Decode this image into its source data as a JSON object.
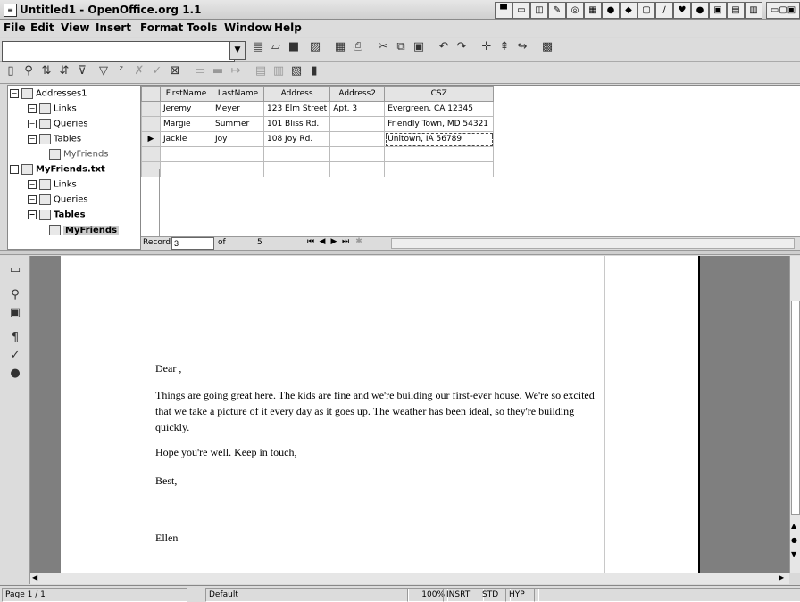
{
  "window": {
    "title": "Untitled1 - OpenOffice.org 1.1"
  },
  "menu": [
    "File",
    "Edit",
    "View",
    "Insert",
    "Format",
    "Tools",
    "Window",
    "Help"
  ],
  "url_field": {
    "value": ""
  },
  "tree": {
    "source1": "Addresses1",
    "source1_links": "Links",
    "source1_queries": "Queries",
    "source1_tables": "Tables",
    "source1_table": "MyFriends",
    "source2": "MyFriends.txt",
    "source2_links": "Links",
    "source2_queries": "Queries",
    "source2_tables": "Tables",
    "source2_table": "MyFriends"
  },
  "grid": {
    "columns": [
      "FirstName",
      "LastName",
      "Address",
      "Address2",
      "CSZ"
    ],
    "rows": [
      [
        "Jeremy",
        "Meyer",
        "123 Elm Street",
        "Apt. 3",
        "Evergreen, CA 12345"
      ],
      [
        "Margie",
        "Summer",
        "101 Bliss Rd.",
        "",
        "Friendly Town, MD 54321"
      ],
      [
        "Jackie",
        "Joy",
        "108 Joy Rd.",
        "",
        "Unitown, IA 56789"
      ],
      [
        "",
        "",
        "",
        "",
        ""
      ],
      [
        "",
        "",
        "",
        "",
        ""
      ]
    ],
    "current_row_marker": "▶"
  },
  "nav": {
    "record_label": "Record",
    "record_value": "3",
    "of_label": "of",
    "total": "5"
  },
  "letter": {
    "greeting": "Dear ,",
    "body1": "Things are going great here. The kids are fine and we're building our first-ever house. We're so excited that we take a picture of it every day as it goes up. The weather has been ideal, so they're building quickly.",
    "body2": "Hope you're well. Keep in touch,",
    "closing": "Best,",
    "signature": "Ellen"
  },
  "status": {
    "page": "Page 1 / 1",
    "style": "Default",
    "zoom": "100%",
    "mode": "INSRT",
    "selection": "STD",
    "hyperlink": "HYP"
  },
  "icons": {
    "toolbar": [
      "edit-file-icon",
      "open-icon",
      "save-icon",
      "edit-doc-icon",
      "export-pdf-icon",
      "print-icon",
      "cut-icon",
      "copy-icon",
      "paste-icon",
      "undo-icon",
      "redo-icon",
      "navigator-icon",
      "stylist-icon",
      "hyperlink-icon",
      "gallery-icon"
    ],
    "dbbar": [
      "explorer-icon",
      "find-icon",
      "sort-ascending-icon",
      "sort-descending-icon",
      "autofilter-icon",
      "standard-filter-icon",
      "remove-filter-icon",
      "data-to-text-icon"
    ]
  }
}
